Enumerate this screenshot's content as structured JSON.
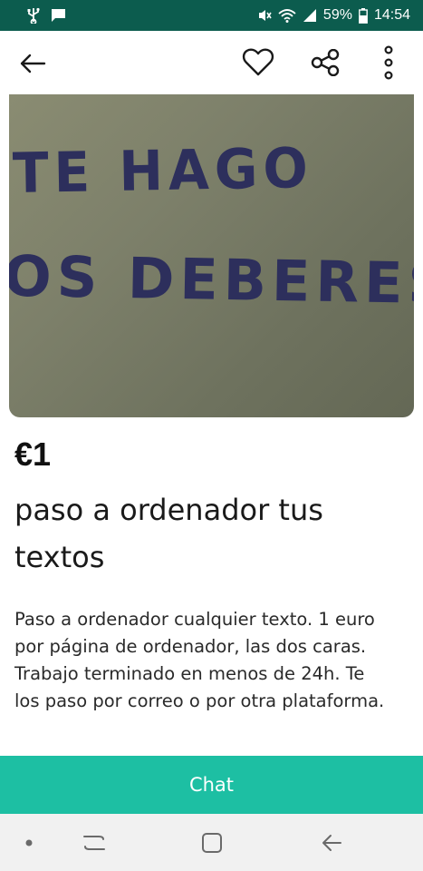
{
  "status_bar": {
    "battery_percent": "59%",
    "time": "14:54",
    "icons": [
      "usb-icon",
      "message-icon",
      "mute-icon",
      "wifi-icon",
      "signal-icon",
      "battery-icon"
    ]
  },
  "app_bar": {
    "icons": [
      "back-arrow-icon",
      "heart-icon",
      "share-icon",
      "more-vertical-icon"
    ]
  },
  "listing": {
    "photo_text_line_1": "TE   HAGO",
    "photo_text_line_2": "OS DEBERES",
    "price": "€1",
    "title": "paso a ordenador tus textos",
    "description": "Paso a ordenador cualquier texto. 1 euro por página de ordenador, las dos caras. Trabajo terminado en menos de 24h. Te los paso por correo o por otra plataforma."
  },
  "chat_button": {
    "label": "Chat",
    "color": "#1dbfa3"
  },
  "colors": {
    "status_bar_bg": "#0c5c4e",
    "accent": "#1dbfa3",
    "nav_bar_bg": "#f1f1f1"
  },
  "nav_bar": {
    "icons": [
      "dot-icon",
      "recent-apps-icon",
      "home-icon",
      "back-icon"
    ]
  }
}
